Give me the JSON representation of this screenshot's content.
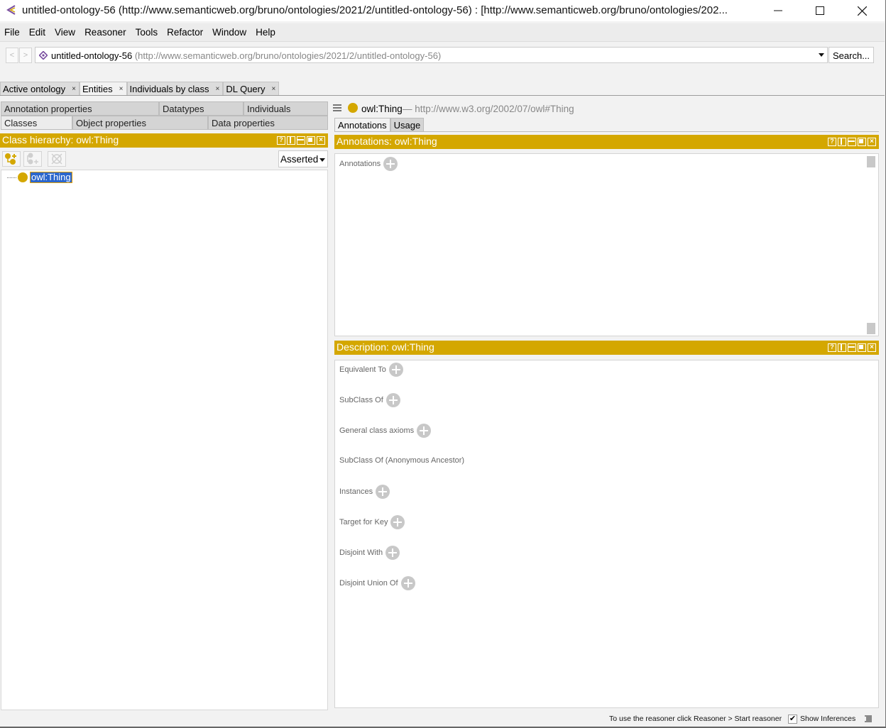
{
  "window": {
    "title": "untitled-ontology-56 (http://www.semanticweb.org/bruno/ontologies/2021/2/untitled-ontology-56)  : [http://www.semanticweb.org/bruno/ontologies/202...",
    "controls": [
      "minimize",
      "maximize",
      "close"
    ]
  },
  "menu": {
    "items": [
      "File",
      "Edit",
      "View",
      "Reasoner",
      "Tools",
      "Refactor",
      "Window",
      "Help"
    ]
  },
  "nav": {
    "back_label": "<",
    "forward_label": ">",
    "ontology_name": "untitled-ontology-56",
    "ontology_iri": "(http://www.semanticweb.org/bruno/ontologies/2021/2/untitled-ontology-56)",
    "search_label": "Search..."
  },
  "main_tabs": [
    {
      "label": "Active ontology",
      "close": "×",
      "active": false
    },
    {
      "label": "Entities",
      "close": "×",
      "active": true
    },
    {
      "label": "Individuals by class",
      "close": "×",
      "active": false
    },
    {
      "label": "DL Query",
      "close": "×",
      "active": false
    }
  ],
  "entity_tabs": {
    "row1": [
      "Annotation properties",
      "Datatypes",
      "Individuals"
    ],
    "row2": [
      "Classes",
      "Object properties",
      "Data properties"
    ],
    "active": "Classes"
  },
  "class_hierarchy": {
    "header": "Class hierarchy: owl:Thing",
    "mode": "Asserted",
    "tools": [
      "add-subclass",
      "add-sibling-class",
      "delete-class"
    ],
    "tree": [
      {
        "label": "owl:Thing",
        "selected": true
      }
    ]
  },
  "view_buttons": {
    "help": "?",
    "close": "×"
  },
  "entity": {
    "name": "owl:Thing",
    "iri": "— http://www.w3.org/2002/07/owl#Thing",
    "tabs": [
      "Annotations",
      "Usage"
    ],
    "active_tab": "Annotations"
  },
  "annotations_view": {
    "header": "Annotations: owl:Thing",
    "sections": [
      {
        "label": "Annotations",
        "addable": true
      }
    ]
  },
  "description_view": {
    "header": "Description: owl:Thing",
    "sections": [
      {
        "label": "Equivalent To",
        "addable": true
      },
      {
        "label": "SubClass Of",
        "addable": true
      },
      {
        "label": "General class axioms",
        "addable": true
      },
      {
        "label": "SubClass Of (Anonymous Ancestor)",
        "addable": false
      },
      {
        "label": "Instances",
        "addable": true
      },
      {
        "label": "Target for Key",
        "addable": true
      },
      {
        "label": "Disjoint With",
        "addable": true
      },
      {
        "label": "Disjoint Union Of",
        "addable": true
      }
    ]
  },
  "statusbar": {
    "message": "To use the reasoner click Reasoner > Start reasoner",
    "show_inferences_label": "Show Inferences",
    "show_inferences_checked": true,
    "check_glyph": "✔"
  },
  "colors": {
    "accent": "#d4a700",
    "selection": "#2b66cc"
  }
}
